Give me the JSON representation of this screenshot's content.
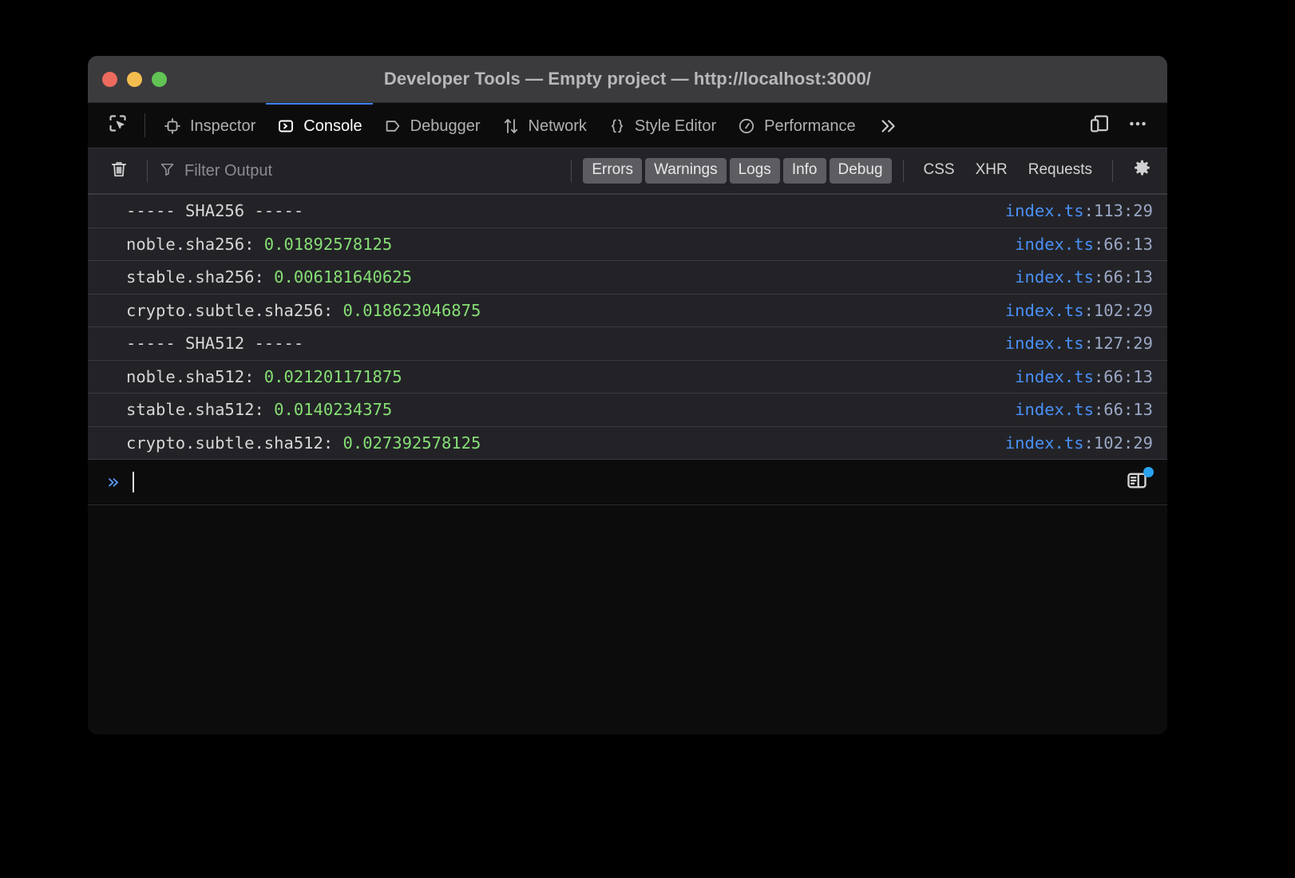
{
  "window": {
    "title": "Developer Tools — Empty project — http://localhost:3000/",
    "traffic_lights": [
      {
        "name": "close",
        "color": "#ec6a5e"
      },
      {
        "name": "minimize",
        "color": "#f4bd4f"
      },
      {
        "name": "zoom",
        "color": "#61c454"
      }
    ]
  },
  "toolbar_tabs": {
    "picker_icon": "element-picker-icon",
    "items": [
      {
        "label": "Inspector",
        "icon": "inspector-icon",
        "active": false
      },
      {
        "label": "Console",
        "icon": "console-icon",
        "active": true
      },
      {
        "label": "Debugger",
        "icon": "debugger-icon",
        "active": false
      },
      {
        "label": "Network",
        "icon": "network-icon",
        "active": false
      },
      {
        "label": "Style Editor",
        "icon": "style-editor-icon",
        "active": false
      },
      {
        "label": "Performance",
        "icon": "performance-icon",
        "active": false
      }
    ],
    "overflow_icon": "chevron-double-right-icon",
    "responsive_icon": "responsive-design-mode-icon",
    "more_icon": "meatball-menu-icon",
    "active_tab_accent": "#3b82f6"
  },
  "console_toolbar": {
    "clear_icon": "trash-icon",
    "filter_icon": "filter-funnel-icon",
    "filter_placeholder": "Filter Output",
    "filter_value": "",
    "severity_filters": [
      {
        "label": "Errors",
        "active": true
      },
      {
        "label": "Warnings",
        "active": true
      },
      {
        "label": "Logs",
        "active": true
      },
      {
        "label": "Info",
        "active": true
      },
      {
        "label": "Debug",
        "active": true
      }
    ],
    "category_filters": [
      {
        "label": "CSS",
        "active": false
      },
      {
        "label": "XHR",
        "active": false
      },
      {
        "label": "Requests",
        "active": false
      }
    ],
    "settings_icon": "gear-icon"
  },
  "console_output": {
    "rows": [
      {
        "text": "----- SHA256 -----",
        "value": "",
        "source_file": "index.ts",
        "source_pos": ":113:29"
      },
      {
        "text": "noble.sha256: ",
        "value": "0.01892578125",
        "source_file": "index.ts",
        "source_pos": ":66:13"
      },
      {
        "text": "stable.sha256: ",
        "value": "0.006181640625",
        "source_file": "index.ts",
        "source_pos": ":66:13"
      },
      {
        "text": "crypto.subtle.sha256: ",
        "value": "0.018623046875",
        "source_file": "index.ts",
        "source_pos": ":102:29"
      },
      {
        "text": "----- SHA512 -----",
        "value": "",
        "source_file": "index.ts",
        "source_pos": ":127:29"
      },
      {
        "text": "noble.sha512: ",
        "value": "0.021201171875",
        "source_file": "index.ts",
        "source_pos": ":66:13"
      },
      {
        "text": "stable.sha512: ",
        "value": "0.0140234375",
        "source_file": "index.ts",
        "source_pos": ":66:13"
      },
      {
        "text": "crypto.subtle.sha512: ",
        "value": "0.027392578125",
        "source_file": "index.ts",
        "source_pos": ":102:29"
      }
    ],
    "value_color": "#86de74",
    "link_color": "#4a90f7"
  },
  "console_input": {
    "prompt": "»",
    "value": "",
    "editor_toggle_icon": "split-console-editor-icon",
    "badge_color": "#2aa3f0"
  }
}
